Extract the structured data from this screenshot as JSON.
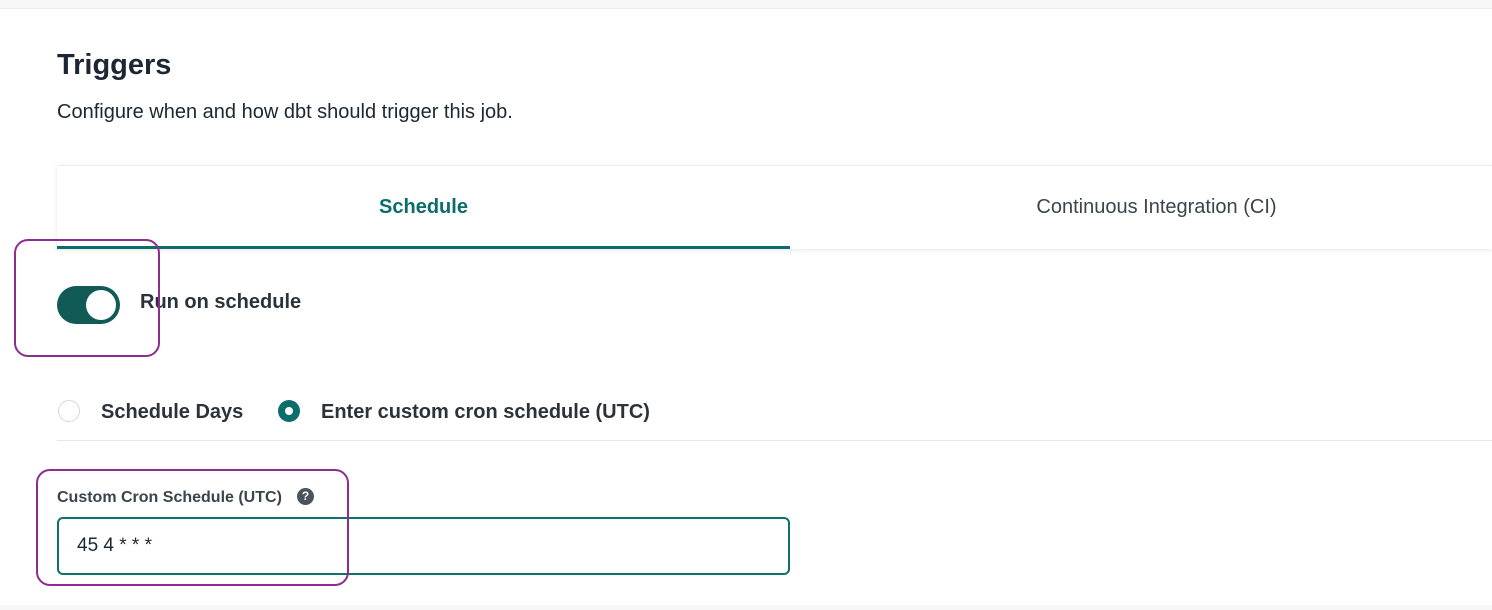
{
  "section": {
    "title": "Triggers",
    "subtitle": "Configure when and how dbt should trigger this job."
  },
  "tabs": [
    {
      "label": "Schedule",
      "active": true
    },
    {
      "label": "Continuous Integration (CI)",
      "active": false
    }
  ],
  "schedule": {
    "toggle": {
      "label": "Run on schedule",
      "on": true
    },
    "radio_options": [
      {
        "label": "Schedule Days",
        "selected": false
      },
      {
        "label": "Enter custom cron schedule (UTC)",
        "selected": true
      }
    ],
    "cron_field": {
      "label": "Custom Cron Schedule (UTC)",
      "help_icon": "question-circle-icon",
      "value": "45 4 * * *"
    }
  },
  "colors": {
    "accent": "#0c6e6a",
    "toggle_on": "#125a56",
    "highlight_annotation": "#8e2d8f",
    "text": "#1c2733"
  }
}
